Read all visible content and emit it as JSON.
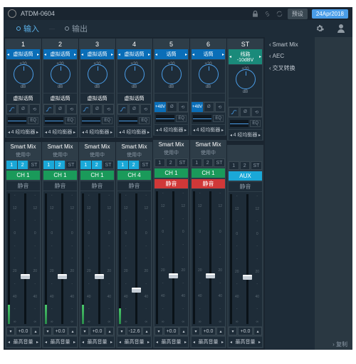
{
  "titlebar": {
    "title": "ATDM-0604",
    "preview": "预设",
    "date": "24Apr2018"
  },
  "nav": {
    "input": "输入",
    "output": "输出"
  },
  "sidebar": {
    "items": [
      {
        "label": "Smart Mix"
      },
      {
        "label": "AEC"
      },
      {
        "label": "交叉转换"
      }
    ]
  },
  "bottom": {
    "copy": "复制"
  },
  "smartmix": {
    "title": "Smart Mix",
    "status": "使用中"
  },
  "eq": {
    "label": "EQ",
    "name": "4 经均衡器"
  },
  "knob": {
    "val": "+20",
    "unit": "dB"
  },
  "buttons": {
    "one": "1",
    "two": "2",
    "st": "ST",
    "mute": "静音",
    "maxvol": "最高音量",
    "phan": "+48V"
  },
  "channels": [
    {
      "num": "1",
      "type": "虚拟话筒",
      "typeColor": "blue",
      "label": "虚拟话筒",
      "ch": "CH 1",
      "chColor": "green",
      "mute": "dark",
      "btns": [
        "cyan",
        "cyan"
      ],
      "fader": 62,
      "val": "+0.0",
      "meter": 15
    },
    {
      "num": "2",
      "type": "虚拟话筒",
      "typeColor": "blue",
      "label": "虚拟话筒",
      "ch": "CH 1",
      "chColor": "green",
      "mute": "dark",
      "btns": [
        "cyan",
        "cyan"
      ],
      "fader": 62,
      "val": "+0.0",
      "meter": 15
    },
    {
      "num": "3",
      "type": "虚拟话筒",
      "typeColor": "blue",
      "label": "虚拟话筒",
      "ch": "CH 1",
      "chColor": "green",
      "mute": "dark",
      "btns": [
        "cyan",
        "cyan"
      ],
      "fader": 62,
      "val": "+0.0",
      "meter": 15
    },
    {
      "num": "4",
      "type": "虚拟话筒",
      "typeColor": "blue",
      "label": "虚拟话筒",
      "ch": "CH 4",
      "chColor": "green",
      "mute": "dark",
      "btns": [
        "cyan",
        "cyan"
      ],
      "fader": 72,
      "val": "-12.6",
      "meter": 12
    },
    {
      "num": "5",
      "type": "话筒",
      "typeColor": "blue",
      "label": "",
      "ch": "CH 1",
      "chColor": "green",
      "mute": "red",
      "btns": [
        "plain",
        "plain"
      ],
      "fader": 62,
      "val": "+0.0",
      "meter": 0,
      "phantom": true
    },
    {
      "num": "6",
      "type": "话筒",
      "typeColor": "blue",
      "label": "",
      "ch": "CH 1",
      "chColor": "green",
      "mute": "red",
      "btns": [
        "plain",
        "plain"
      ],
      "fader": 62,
      "val": "+0.0",
      "meter": 0,
      "phantom": true
    },
    {
      "num": "ST",
      "type": "线路 -10dBV",
      "typeColor": "green",
      "label": "",
      "ch": "AUX",
      "chColor": "cyan",
      "mute": "dark",
      "btns": [
        "plain",
        "plain"
      ],
      "fader": 62,
      "val": "+0.0",
      "meter": 0,
      "noSmart": true
    }
  ]
}
